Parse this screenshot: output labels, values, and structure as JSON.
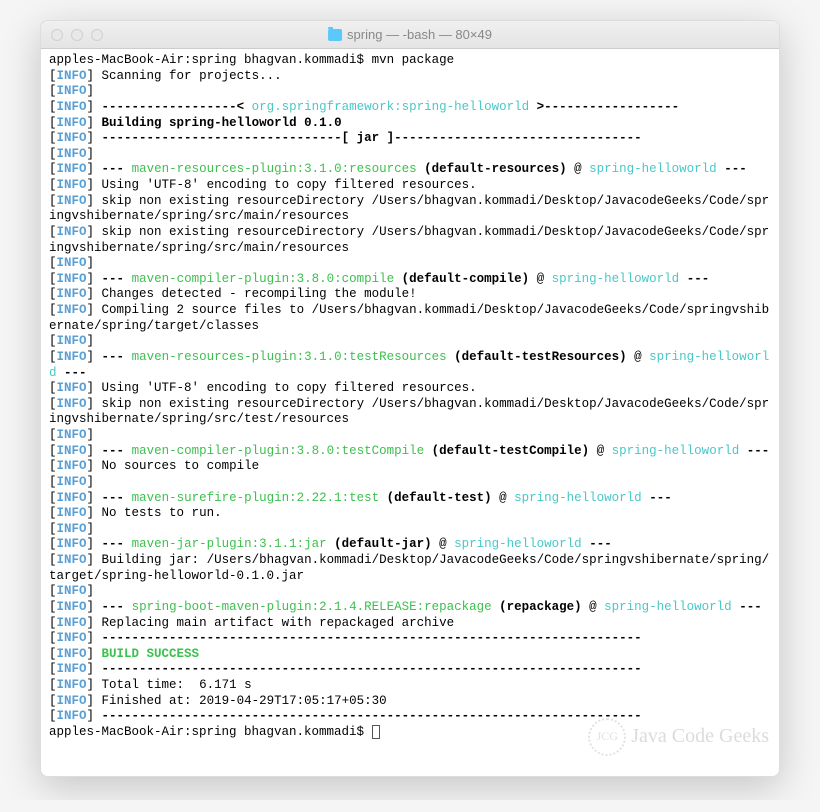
{
  "window": {
    "title": "spring — -bash — 80×49"
  },
  "prompt": {
    "prefix": "apples-MacBook-Air:spring bhagvan.kommadi$ ",
    "command": "mvn package",
    "end_prefix": "apples-MacBook-Air:spring bhagvan.kommadi$ "
  },
  "lines": {
    "scanning": "Scanning for projects...",
    "empty": "",
    "proj_dashes_pre": " ------------------< ",
    "proj_name": "org.springframework:spring-helloworld",
    "proj_dashes_post": " >------------------",
    "building": "Building spring-helloworld 0.1.0",
    "jar_line": " --------------------------------[ jar ]---------------------------------",
    "res_plugin": "--- ",
    "res_plugin_name": "maven-resources-plugin:3.1.0:resources",
    "res_plugin_goal": " (default-resources)",
    "res_plugin_at": " @ ",
    "res_plugin_proj": "spring-helloworld",
    "res_plugin_end": " ---",
    "utf8": "Using 'UTF-8' encoding to copy filtered resources.",
    "skip_main1": "skip non existing resourceDirectory /Users/bhagvan.kommadi/Desktop/JavacodeGeeks/Code/springvshibernate/spring/src/main/resources",
    "skip_main2": "skip non existing resourceDirectory /Users/bhagvan.kommadi/Desktop/JavacodeGeeks/Code/springvshibernate/spring/src/main/resources",
    "compiler_plugin_name": "maven-compiler-plugin:3.8.0:compile",
    "compiler_plugin_goal": " (default-compile)",
    "compiler_proj": "spring-helloworld",
    "changes": "Changes detected - recompiling the module!",
    "compiling": "Compiling 2 source files to /Users/bhagvan.kommadi/Desktop/JavacodeGeeks/Code/springvshibernate/spring/target/classes",
    "testres_plugin_name": "maven-resources-plugin:3.1.0:testResources",
    "testres_goal": " (default-testResources)",
    "testres_proj": "spring-helloworld",
    "skip_test": "skip non existing resourceDirectory /Users/bhagvan.kommadi/Desktop/JavacodeGeeks/Code/springvshibernate/spring/src/test/resources",
    "testcompile_name": "maven-compiler-plugin:3.8.0:testCompile",
    "testcompile_goal": " (default-testCompile)",
    "testcompile_proj": "spring-helloworld",
    "no_sources": "No sources to compile",
    "surefire_name": "maven-surefire-plugin:2.22.1:test",
    "surefire_goal": " (default-test)",
    "surefire_proj": "spring-helloworld",
    "no_tests": "No tests to run.",
    "jar_plugin_name": "maven-jar-plugin:3.1.1:jar",
    "jar_plugin_goal": " (default-jar)",
    "jar_plugin_proj": "spring-helloworld",
    "building_jar": "Building jar: /Users/bhagvan.kommadi/Desktop/JavacodeGeeks/Code/springvshibernate/spring/target/spring-helloworld-0.1.0.jar",
    "boot_plugin_name": "spring-boot-maven-plugin:2.1.4.RELEASE:repackage",
    "boot_plugin_goal": " (repackage)",
    "boot_plugin_proj": "spring-helloworld",
    "replacing": "Replacing main artifact with repackaged archive",
    "dash72": " ------------------------------------------------------------------------",
    "build_success": "BUILD SUCCESS",
    "total_time": "Total time:  6.171 s",
    "finished": "Finished at: 2019-04-29T17:05:17+05:30"
  },
  "watermark": {
    "initials": "JCG",
    "text": "Java Code Geeks"
  }
}
